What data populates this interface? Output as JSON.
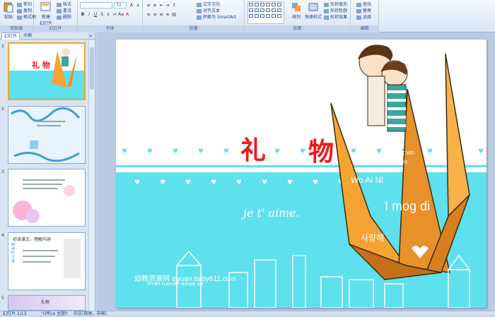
{
  "ribbon": {
    "clipboard": {
      "paste": "粘贴",
      "cut": "剪切",
      "copy": "复制",
      "format_painter": "格式刷",
      "group": "剪贴板"
    },
    "slides": {
      "new_slide": "新建\n幻灯片",
      "layout": "版式",
      "reset": "重设",
      "delete": "删除",
      "group": "幻灯片"
    },
    "font": {
      "size": "72",
      "group": "字体"
    },
    "paragraph": {
      "text_direction": "文字方向",
      "align_text": "对齐文本",
      "smartart": "转换为 SmartArt",
      "group": "段落"
    },
    "drawing": {
      "arrange": "排列",
      "quick_styles": "快速样式",
      "shape_fill": "形状填充",
      "shape_outline": "形状轮廓",
      "shape_effects": "形状效果",
      "group": "绘图"
    },
    "editing": {
      "find": "查找",
      "replace": "替换",
      "select": "选择",
      "group": "编辑"
    }
  },
  "leftpane": {
    "tab_slides": "幻灯片",
    "tab_outline": "大纲",
    "close": "×",
    "thumbs": [
      {
        "num": "1",
        "title": "礼 物"
      },
      {
        "num": "2"
      },
      {
        "num": "3"
      },
      {
        "num": "4",
        "title": "初读课文，理解内容",
        "side": "朗读时注意"
      },
      {
        "num": "5",
        "title": "礼物"
      }
    ]
  },
  "slide": {
    "title_char1": "礼",
    "title_char2": "物",
    "words": [
      "amat vin",
      "Ik hou van jou",
      "Wo Ai Ni",
      "I mog di",
      "사랑해"
    ],
    "cursive": "je t' aime.",
    "site": "幼教资源网 ziyuan.baby611.com",
    "site_sub": "PPT课件  FLASH课件  教养指南  试卷"
  },
  "status": {
    "slide_count": "幻灯片 1/13",
    "theme": "\"Office 主题\"",
    "language": "中文(简体，中国)"
  },
  "colors": {
    "band": "#5fe0ee",
    "title": "#f01818",
    "crane": "#f5a433"
  }
}
